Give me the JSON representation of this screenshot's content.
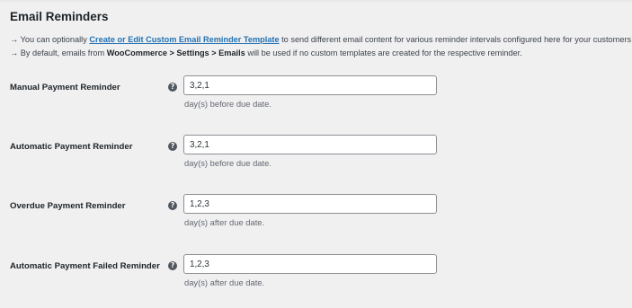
{
  "section": {
    "title": "Email Reminders"
  },
  "description": {
    "line1_arrow": "→ You can optionally ",
    "line1_link": "Create or Edit Custom Email Reminder Template",
    "line1_rest": " to send different email content for various reminder intervals configured here for your customers.",
    "line2_prefix": "→ By default, emails from ",
    "line2_path": "WooCommerce > Settings > Emails",
    "line2_rest": " will be used if no custom templates are created for the respective reminder."
  },
  "fields": [
    {
      "label": "Manual Payment Reminder",
      "help_icon": "question-circle-icon",
      "value": "3,2,1",
      "hint": "day(s) before due date."
    },
    {
      "label": "Automatic Payment Reminder",
      "help_icon": "question-circle-icon",
      "value": "3,2,1",
      "hint": "day(s) before due date."
    },
    {
      "label": "Overdue Payment Reminder",
      "help_icon": "question-circle-icon",
      "value": "1,2,3",
      "hint": "day(s) after due date."
    },
    {
      "label": "Automatic Payment Failed Reminder",
      "help_icon": "question-circle-icon",
      "value": "1,2,3",
      "hint": "day(s) after due date."
    }
  ],
  "colors": {
    "background": "#f0f0f1",
    "link": "#2271b1",
    "text": "#1d2327",
    "muted": "#646970"
  }
}
